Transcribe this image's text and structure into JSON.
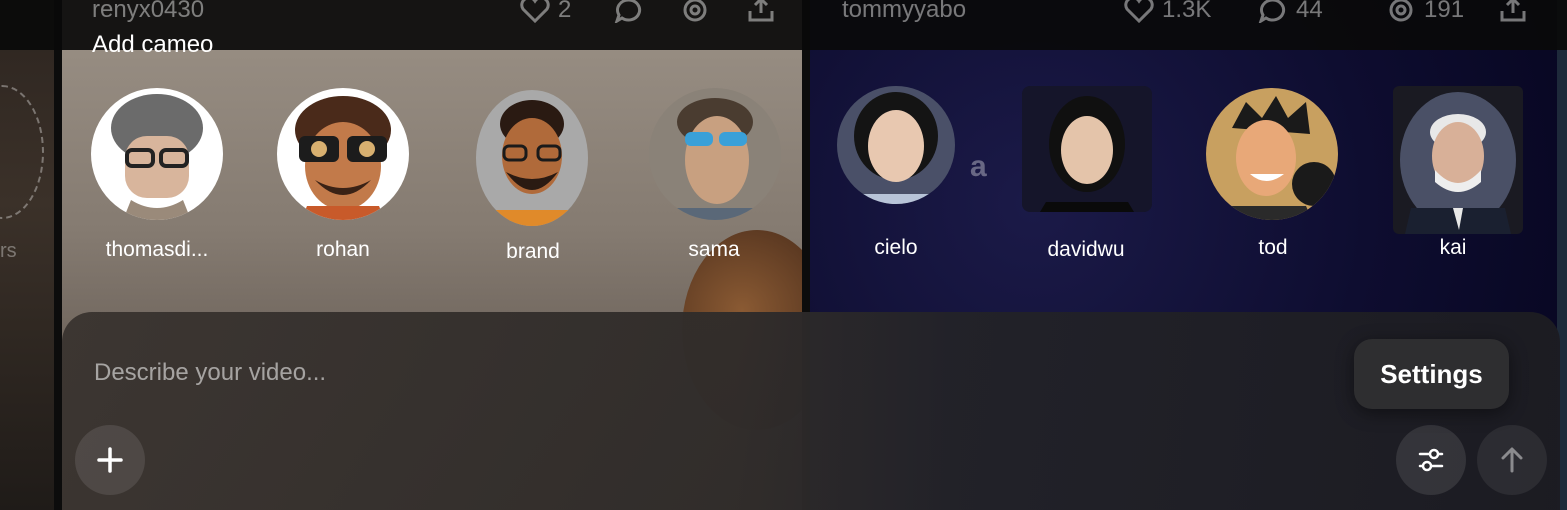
{
  "feed_meta": {
    "left": {
      "username": "renyx0430",
      "likes": "2"
    },
    "right": {
      "username": "tommyyabo",
      "likes": "1.3K",
      "comments": "44",
      "remixes": "191"
    }
  },
  "cameo_picker": {
    "label": "Add cameo",
    "cameos": [
      {
        "name": "thomasdi..."
      },
      {
        "name": "rohan"
      },
      {
        "name": "brand"
      },
      {
        "name": "sama"
      },
      {
        "name": "cielo"
      },
      {
        "name": "davidwu"
      },
      {
        "name": "tod"
      },
      {
        "name": "kai"
      }
    ]
  },
  "composer": {
    "placeholder": "Describe your video...",
    "settings_tooltip": "Settings",
    "icons": {
      "add": "plus-icon",
      "settings": "sliders-icon",
      "submit": "arrow-up-icon"
    }
  },
  "background": {
    "left_edge_text": "rs",
    "right_tile_letter": "a"
  },
  "colors": {
    "panel": "#2f2c2b",
    "text": "#ffffff",
    "muted": "#8c8c8c"
  }
}
